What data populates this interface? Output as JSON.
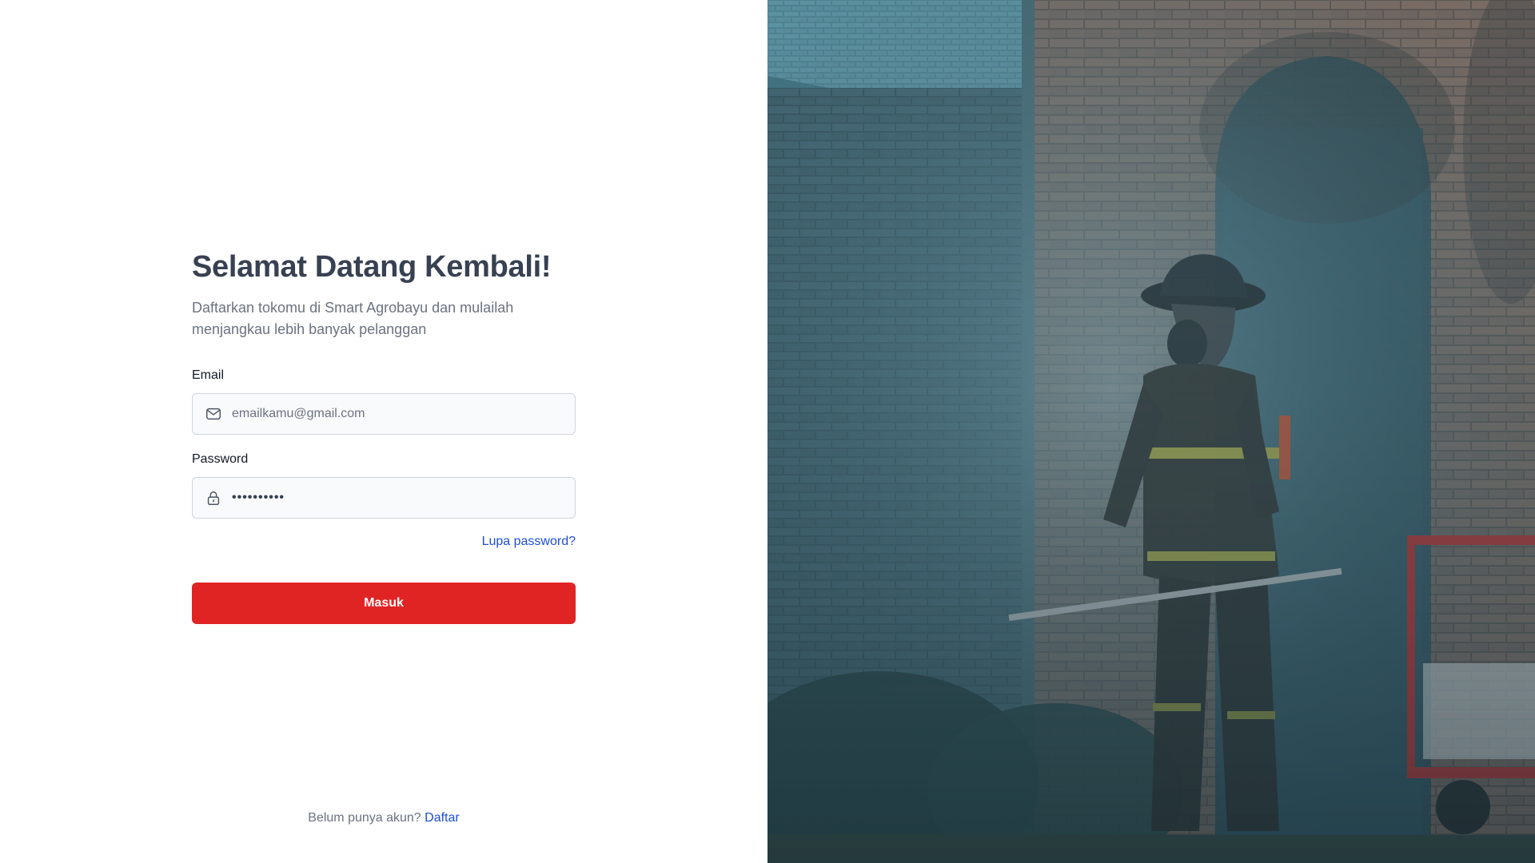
{
  "login": {
    "title": "Selamat Datang Kembali!",
    "subtitle": "Daftarkan tokomu di Smart Agrobayu dan mulailah menjangkau lebih banyak pelanggan",
    "email_label": "Email",
    "email_placeholder": "emailkamu@gmail.com",
    "email_icon": "mail-icon",
    "password_label": "Password",
    "password_value": "••••••••••",
    "password_icon": "lock-icon",
    "forgot_link": "Lupa password?",
    "submit_label": "Masuk",
    "signup_prompt": "Belum punya akun?",
    "signup_link": "Daftar"
  },
  "colors": {
    "primary_button": "#e02424",
    "link": "#1d4ed8",
    "title": "#374151"
  },
  "hero": {
    "image_subject": "firefighter-walking-by-smoky-brick-building"
  }
}
